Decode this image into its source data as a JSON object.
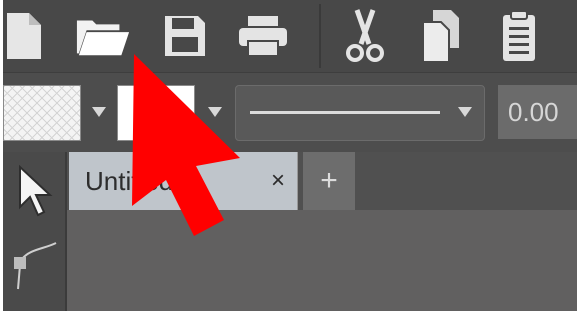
{
  "toolbar": {
    "buttons": [
      {
        "name": "new-file",
        "icon": "new-file-icon"
      },
      {
        "name": "open-folder",
        "icon": "open-folder-icon"
      },
      {
        "name": "save",
        "icon": "floppy-disk-icon"
      },
      {
        "name": "print",
        "icon": "printer-icon"
      },
      {
        "name": "cut",
        "icon": "scissors-icon"
      },
      {
        "name": "copy",
        "icon": "copy-icon"
      },
      {
        "name": "paste",
        "icon": "clipboard-icon"
      }
    ]
  },
  "properties": {
    "fill_pattern": "crosshatch",
    "stroke_color": "#ffffff",
    "line_style": "solid",
    "line_width": "0.00"
  },
  "tools": [
    {
      "name": "select",
      "icon": "arrow-pointer-icon"
    },
    {
      "name": "node",
      "icon": "bezier-node-icon"
    }
  ],
  "tabs": {
    "active_title": "Untitled-1",
    "close_glyph": "×",
    "add_glyph": "+"
  },
  "annotation": {
    "pointer_icon": "red-arrow-pointer-icon",
    "pointer_color": "#ff0000"
  },
  "colors": {
    "toolbar_bg": "#484848",
    "tab_active_bg": "#bfc5cb",
    "canvas_bg": "#616060"
  }
}
